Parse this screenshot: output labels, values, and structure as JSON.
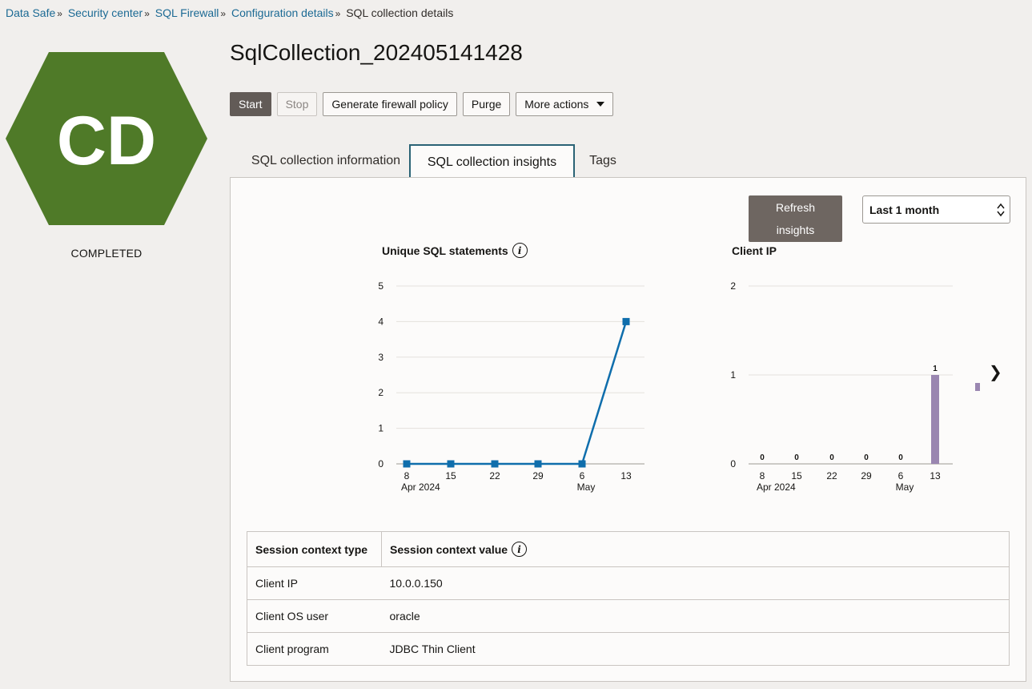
{
  "breadcrumb": {
    "items": [
      "Data Safe",
      "Security center",
      "SQL Firewall",
      "Configuration details"
    ],
    "current": "SQL collection details"
  },
  "badge": {
    "initials": "CD",
    "status": "COMPLETED",
    "color": "#4f7a28"
  },
  "page_title": "SqlCollection_202405141428",
  "actions": {
    "start": "Start",
    "stop": "Stop",
    "generate": "Generate firewall policy",
    "purge": "Purge",
    "more": "More actions"
  },
  "tabs": [
    "SQL collection information",
    "SQL collection insights",
    "Tags"
  ],
  "active_tab": "SQL collection insights",
  "insights": {
    "refresh_label_1": "Refresh",
    "refresh_label_2": "insights",
    "range": "Last 1 month"
  },
  "chart_data": [
    {
      "type": "line",
      "title": "Unique SQL statements",
      "x": [
        "8",
        "15",
        "22",
        "29",
        "6",
        "13"
      ],
      "x_sublabels": [
        "Apr 2024",
        "",
        "",
        "",
        "May",
        ""
      ],
      "ylim": [
        0,
        5
      ],
      "yticks": [
        "0",
        "1",
        "2",
        "3",
        "4",
        "5"
      ],
      "series": [
        {
          "values": [
            0,
            0,
            0,
            0,
            0,
            4
          ],
          "color": "#0f6eac"
        }
      ]
    },
    {
      "type": "bar",
      "title": "Client IP",
      "x": [
        "8",
        "15",
        "22",
        "29",
        "6",
        "13"
      ],
      "x_sublabels": [
        "Apr 2024",
        "",
        "",
        "",
        "May",
        ""
      ],
      "ylim": [
        0,
        2
      ],
      "yticks": [
        "0",
        "1",
        "2"
      ],
      "series": [
        {
          "values": [
            0,
            0,
            0,
            0,
            0,
            1
          ],
          "color": "#9a86b0"
        }
      ],
      "data_labels": [
        "0",
        "0",
        "0",
        "0",
        "0",
        "1"
      ]
    }
  ],
  "table": {
    "headers": [
      "Session context type",
      "Session context value"
    ],
    "rows": [
      [
        "Client IP",
        "10.0.0.150"
      ],
      [
        "Client OS user",
        "oracle"
      ],
      [
        "Client program",
        "JDBC Thin Client"
      ]
    ]
  }
}
